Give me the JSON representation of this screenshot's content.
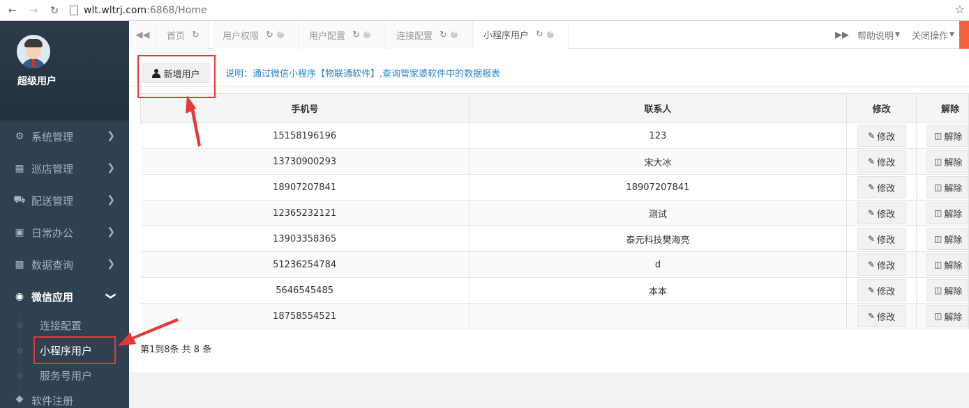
{
  "browser": {
    "url_host": "wlt.wltrj.com",
    "url_rest": ":6868/Home",
    "back_icon": "arrow-left-icon",
    "forward_icon": "arrow-right-icon",
    "reload_icon": "reload-icon"
  },
  "sidebar": {
    "user_name": "超级用户",
    "menu": [
      {
        "label": "系统管理",
        "icon": "gears-icon"
      },
      {
        "label": "巡店管理",
        "icon": "sitemap-icon"
      },
      {
        "label": "配送管理",
        "icon": "truck-icon"
      },
      {
        "label": "日常办公",
        "icon": "briefcase-icon"
      },
      {
        "label": "数据查询",
        "icon": "bar-chart-icon"
      },
      {
        "label": "微信应用",
        "icon": "wechat-icon"
      }
    ],
    "wechat_submenu": [
      "连接配置",
      "小程序用户",
      "服务号用户"
    ],
    "next_menu_partial": "软件注册"
  },
  "tabs": [
    {
      "label": "首页"
    },
    {
      "label": "用户权限"
    },
    {
      "label": "用户配置"
    },
    {
      "label": "连接配置"
    },
    {
      "label": "小程序用户"
    }
  ],
  "tab_actions": {
    "help": "帮助说明",
    "close_ops": "关闭操作"
  },
  "toolbar": {
    "add_user": "新增用户",
    "note": "说明：通过微信小程序【物联通软件】,查询管家婆软件中的数据报表"
  },
  "table": {
    "headers": [
      "手机号",
      "联系人",
      "修改",
      "解除"
    ],
    "edit_label": "修改",
    "delete_label": "解除",
    "rows": [
      {
        "phone": "15158196196",
        "contact": "123"
      },
      {
        "phone": "13730900293",
        "contact": "宋大冰"
      },
      {
        "phone": "18907207841",
        "contact": "18907207841"
      },
      {
        "phone": "12365232121",
        "contact": "测试"
      },
      {
        "phone": "13903358365",
        "contact": "泰元科技樊海亮"
      },
      {
        "phone": "51236254784",
        "contact": "d"
      },
      {
        "phone": "5646545485",
        "contact": "本本"
      },
      {
        "phone": "18758554521",
        "contact": ""
      }
    ]
  },
  "pagination": {
    "info": "第1到8条 共 8 条"
  },
  "colors": {
    "sidebar_bg": "#2f4050",
    "annotation_red": "#e53935",
    "note_blue": "#2a85c8",
    "tab_orange": "#f3603a"
  }
}
